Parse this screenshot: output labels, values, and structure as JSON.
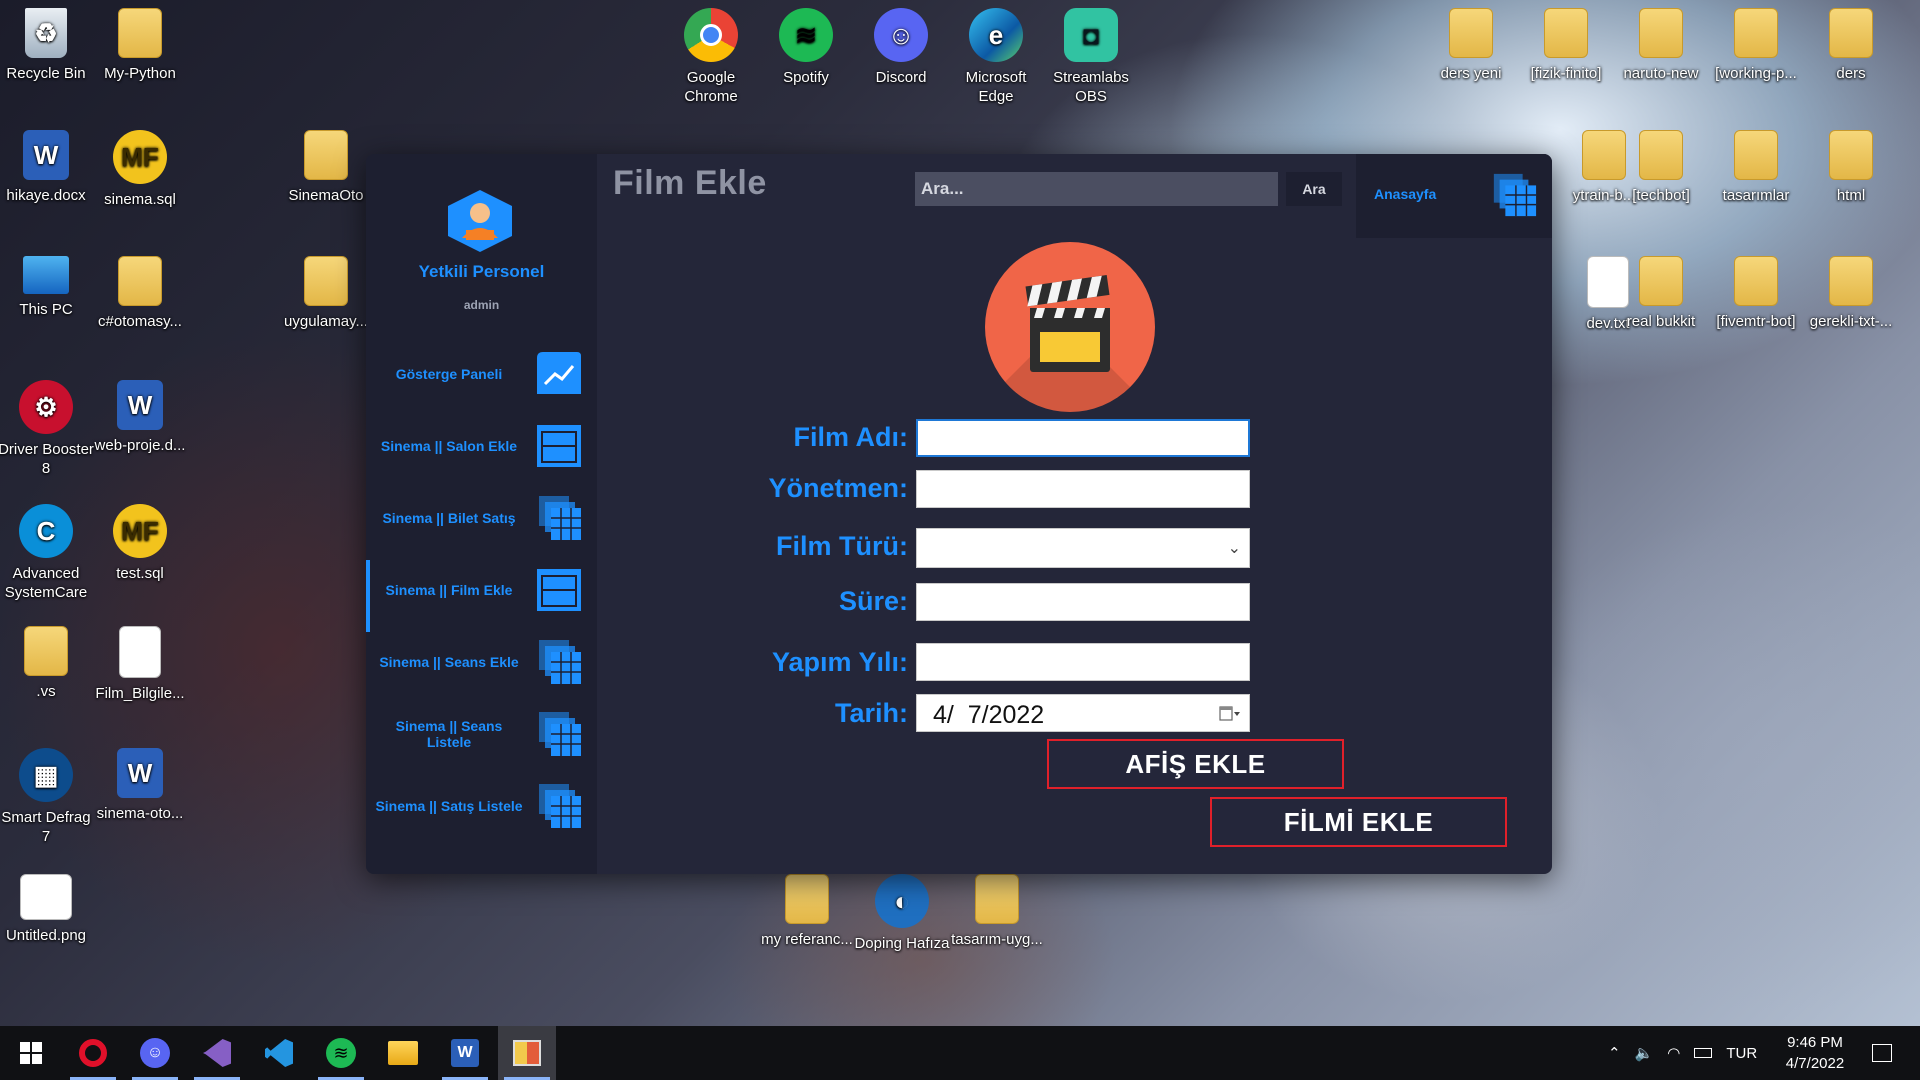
{
  "desktop": {
    "icons_left": [
      {
        "label": "Recycle Bin",
        "icon": "recycle-bin-icon"
      },
      {
        "label": "My-Python",
        "icon": "folder-icon"
      },
      {
        "label": "hikaye.docx",
        "icon": "word-doc-icon"
      },
      {
        "label": "sinema.sql",
        "icon": "mysql-file-icon"
      },
      {
        "label": "SinemaOto",
        "icon": "folder-icon"
      },
      {
        "label": "This PC",
        "icon": "pc-icon"
      },
      {
        "label": "c#otomasy...",
        "icon": "folder-icon"
      },
      {
        "label": "uygulamay...",
        "icon": "folder-icon"
      },
      {
        "label": "Driver Booster 8",
        "icon": "driver-booster-icon"
      },
      {
        "label": "web-proje.d...",
        "icon": "word-doc-icon"
      },
      {
        "label": "Advanced SystemCare",
        "icon": "advanced-systemcare-icon"
      },
      {
        "label": "test.sql",
        "icon": "mysql-file-icon"
      },
      {
        "label": ".vs",
        "icon": "folder-icon"
      },
      {
        "label": "Film_Bilgile...",
        "icon": "text-file-icon"
      },
      {
        "label": "Smart Defrag 7",
        "icon": "smart-defrag-icon"
      },
      {
        "label": "sinema-oto...",
        "icon": "word-doc-icon"
      },
      {
        "label": "Untitled.png",
        "icon": "image-file-icon"
      }
    ],
    "icons_top": [
      {
        "label": "Google Chrome",
        "icon": "chrome-icon"
      },
      {
        "label": "Spotify",
        "icon": "spotify-icon"
      },
      {
        "label": "Discord",
        "icon": "discord-icon"
      },
      {
        "label": "Microsoft Edge",
        "icon": "edge-icon"
      },
      {
        "label": "Streamlabs OBS",
        "icon": "streamlabs-icon"
      }
    ],
    "icons_right": [
      {
        "label": "ders yeni",
        "icon": "folder-icon"
      },
      {
        "label": "[fizik-finito]",
        "icon": "folder-icon"
      },
      {
        "label": "naruto-new",
        "icon": "folder-icon"
      },
      {
        "label": "[working-p...",
        "icon": "folder-icon"
      },
      {
        "label": "ders",
        "icon": "folder-icon"
      },
      {
        "label": "ytrain-b...",
        "icon": "folder-icon"
      },
      {
        "label": "[techbot]",
        "icon": "folder-icon"
      },
      {
        "label": "tasarımlar",
        "icon": "folder-icon"
      },
      {
        "label": "html",
        "icon": "folder-icon"
      },
      {
        "label": "dev.txt",
        "icon": "text-file-icon"
      },
      {
        "label": "real bukkit",
        "icon": "folder-icon"
      },
      {
        "label": "[fivemtr-bot]",
        "icon": "folder-icon"
      },
      {
        "label": "gerekli-txt-...",
        "icon": "folder-icon"
      }
    ],
    "icons_bottom": [
      {
        "label": "my referanc...",
        "icon": "folder-icon"
      },
      {
        "label": "Doping Hafıza",
        "icon": "doping-icon"
      },
      {
        "label": "tasarım-uyg...",
        "icon": "folder-icon"
      }
    ]
  },
  "app": {
    "profile": {
      "name": "Yetkili Personel",
      "role": "admin"
    },
    "nav": [
      {
        "label": "Gösterge Paneli",
        "icon": "chart-icon"
      },
      {
        "label": "Sinema || Salon Ekle",
        "icon": "window-icon"
      },
      {
        "label": "Sinema || Bilet Satış",
        "icon": "stack-icon"
      },
      {
        "label": "Sinema || Film Ekle",
        "icon": "window-icon"
      },
      {
        "label": "Sinema || Seans Ekle",
        "icon": "stack-icon"
      },
      {
        "label": "Sinema || Seans Listele",
        "icon": "stack-icon"
      },
      {
        "label": "Sinema || Satış Listele",
        "icon": "stack-icon"
      }
    ],
    "title": "Film Ekle",
    "search": {
      "placeholder": "Ara...",
      "button": "Ara"
    },
    "home": {
      "label": "Anasayfa"
    },
    "form": {
      "film_adi": {
        "label": "Film Adı:",
        "value": ""
      },
      "yonetmen": {
        "label": "Yönetmen:",
        "value": ""
      },
      "film_turu": {
        "label": "Film Türü:",
        "value": ""
      },
      "sure": {
        "label": "Süre:",
        "value": ""
      },
      "yapim_yili": {
        "label": "Yapım Yılı:",
        "value": ""
      },
      "tarih": {
        "label": "Tarih:",
        "value": "4/  7/2022"
      }
    },
    "buttons": {
      "afis_ekle": "AFİŞ EKLE",
      "filmi_ekle": "FİLMİ EKLE"
    },
    "colors": {
      "accent": "#1e90ff",
      "panel": "#242639",
      "sidebar": "#1d1f30",
      "button_border": "#e0202a"
    }
  },
  "taskbar": {
    "apps": [
      "start-icon",
      "opera-icon",
      "discord-icon",
      "visual-studio-icon",
      "vscode-icon",
      "spotify-icon",
      "file-explorer-icon",
      "word-icon",
      "winforms-app-icon"
    ],
    "tray": {
      "language": "TUR",
      "time": "9:46 PM",
      "date": "4/7/2022"
    }
  }
}
